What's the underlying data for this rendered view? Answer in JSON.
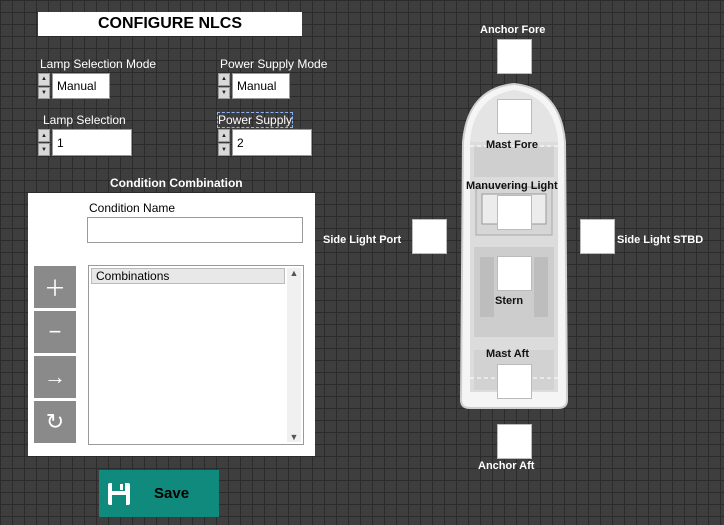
{
  "title": "CONFIGURE NLCS",
  "lamp_selection_mode": {
    "label": "Lamp Selection Mode",
    "value": "Manual"
  },
  "power_supply_mode": {
    "label": "Power Supply Mode",
    "value": "Manual"
  },
  "lamp_selection": {
    "label": "Lamp Selection",
    "value": "1"
  },
  "power_supply": {
    "label": "Power Supply",
    "value": "2"
  },
  "condition": {
    "section_title": "Condition Combination",
    "name_label": "Condition Name",
    "name_value": "",
    "combinations_header": "Combinations"
  },
  "buttons": {
    "add_icon": "plus-icon",
    "remove_icon": "minus-icon",
    "move_icon": "arrow-right-icon",
    "refresh_icon": "refresh-icon",
    "save_label": "Save"
  },
  "lights": {
    "anchor_fore": "Anchor Fore",
    "mast_fore": "Mast Fore",
    "manuvering_light": "Manuvering Light",
    "side_light_port": "Side Light  Port",
    "side_light_stbd": "Side Light STBD",
    "stern": "Stern",
    "mast_aft": "Mast Aft",
    "anchor_aft": "Anchor Aft"
  },
  "colors": {
    "background": "#3e3e3e",
    "save_button": "#0f8a7c",
    "panel": "#ffffff",
    "side_buttons": "#8a8a8a"
  }
}
